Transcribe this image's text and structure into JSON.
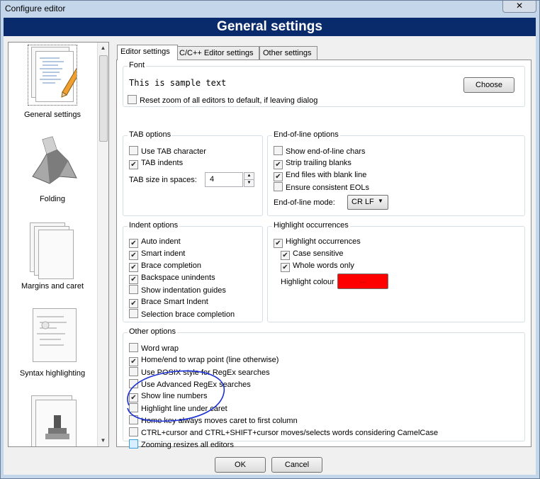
{
  "window": {
    "title": "Configure editor",
    "close": "✕"
  },
  "banner": "General settings",
  "sidebar": {
    "items": [
      {
        "label": "General settings",
        "icon": "general-settings-icon"
      },
      {
        "label": "Folding",
        "icon": "folding-icon"
      },
      {
        "label": "Margins and caret",
        "icon": "margins-icon"
      },
      {
        "label": "Syntax highlighting",
        "icon": "syntax-icon"
      },
      {
        "label": "",
        "icon": "stamp-icon"
      }
    ]
  },
  "tabs": [
    "Editor settings",
    "C/C++ Editor settings",
    "Other settings"
  ],
  "font": {
    "title": "Font",
    "sample": "This is sample text",
    "choose": "Choose",
    "reset_zoom": "Reset zoom of all editors to default, if leaving dialog"
  },
  "tab_options": {
    "title": "TAB options",
    "use_tab": "Use TAB character",
    "tab_indents": "TAB indents",
    "tab_size_label": "TAB size in spaces:",
    "tab_size_value": "4"
  },
  "eol_options": {
    "title": "End-of-line options",
    "show_eol": "Show end-of-line chars",
    "strip": "Strip trailing blanks",
    "end_blank": "End files with blank line",
    "ensure": "Ensure consistent EOLs",
    "mode_label": "End-of-line mode:",
    "mode_value": "CR LF"
  },
  "indent_options": {
    "title": "Indent options",
    "items": [
      "Auto indent",
      "Smart indent",
      "Brace completion",
      "Backspace unindents",
      "Show indentation guides",
      "Brace Smart Indent",
      "Selection brace completion"
    ]
  },
  "highlight": {
    "title": "Highlight occurrences",
    "main": "Highlight occurrences",
    "case": "Case sensitive",
    "whole": "Whole words only",
    "colour_label": "Highlight colour",
    "colour_btn": "...",
    "colour": "#ff0000"
  },
  "other_options": {
    "title": "Other options",
    "items": [
      "Word wrap",
      "Home/end to wrap point (line otherwise)",
      "Use POSIX style for RegEx searches",
      "Use Advanced RegEx searches",
      "Show line numbers",
      "Highlight line under caret",
      "Home key always moves caret to first column",
      "CTRL+cursor and CTRL+SHIFT+cursor moves/selects words considering CamelCase",
      "Zooming resizes all editors"
    ]
  },
  "buttons": {
    "ok": "OK",
    "cancel": "Cancel"
  },
  "annotation_color": "#1a2fd6"
}
